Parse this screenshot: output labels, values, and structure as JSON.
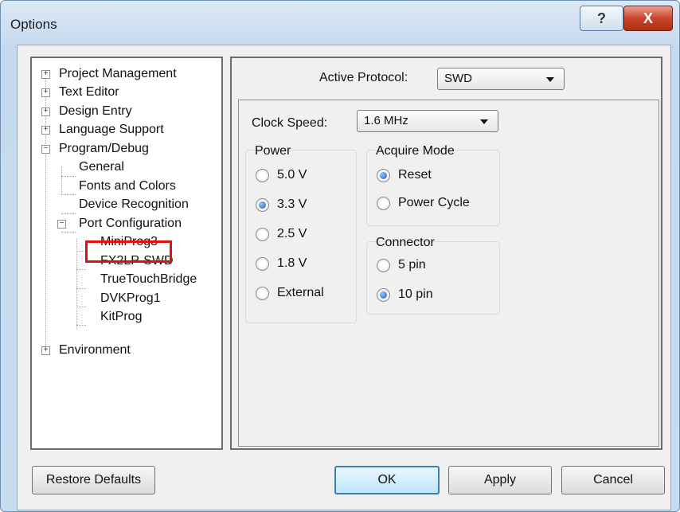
{
  "window": {
    "title": "Options",
    "help_label": "?",
    "close_label": "X"
  },
  "tree": {
    "items": [
      {
        "label": "Project Management",
        "expander": "+"
      },
      {
        "label": "Text Editor",
        "expander": "+"
      },
      {
        "label": "Design Entry",
        "expander": "+"
      },
      {
        "label": "Language Support",
        "expander": "+"
      },
      {
        "label": "Program/Debug",
        "expander": "−"
      },
      {
        "label": "General"
      },
      {
        "label": "Fonts and Colors"
      },
      {
        "label": "Device Recognition"
      },
      {
        "label": "Port Configuration",
        "expander": "−"
      },
      {
        "label": "MiniProg3"
      },
      {
        "label": "FX2LP-SWD"
      },
      {
        "label": "TrueTouchBridge"
      },
      {
        "label": "DVKProg1"
      },
      {
        "label": "KitProg"
      },
      {
        "label": "Environment",
        "expander": "+"
      }
    ]
  },
  "protocol": {
    "label": "Active Protocol:",
    "value": "SWD"
  },
  "clock": {
    "label": "Clock Speed:",
    "value": "1.6 MHz"
  },
  "power": {
    "title": "Power",
    "options": [
      {
        "label": "5.0 V",
        "selected": false
      },
      {
        "label": "3.3 V",
        "selected": true
      },
      {
        "label": "2.5 V",
        "selected": false
      },
      {
        "label": "1.8 V",
        "selected": false
      },
      {
        "label": "External",
        "selected": false
      }
    ]
  },
  "acquire": {
    "title": "Acquire Mode",
    "options": [
      {
        "label": "Reset",
        "selected": true
      },
      {
        "label": "Power Cycle",
        "selected": false
      }
    ]
  },
  "connector": {
    "title": "Connector",
    "options": [
      {
        "label": "5 pin",
        "selected": false
      },
      {
        "label": "10 pin",
        "selected": true
      }
    ]
  },
  "buttons": {
    "restore": "Restore Defaults",
    "ok": "OK",
    "apply": "Apply",
    "cancel": "Cancel"
  }
}
